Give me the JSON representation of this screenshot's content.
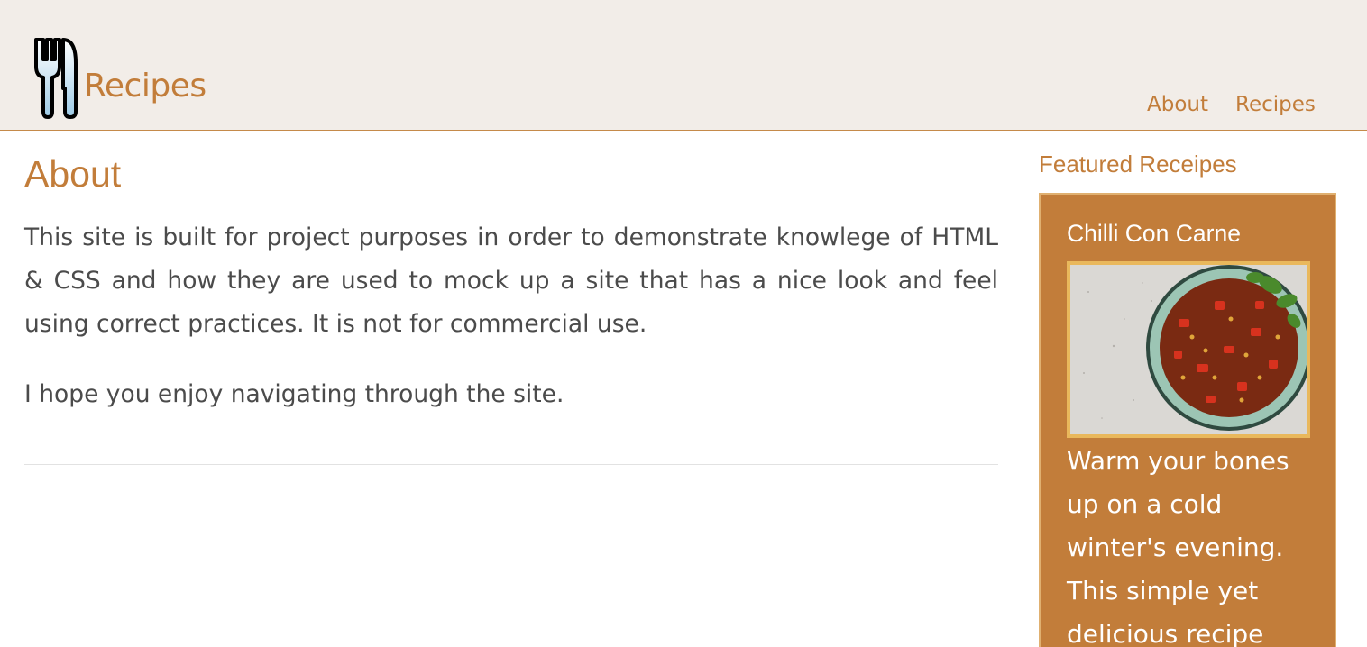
{
  "header": {
    "brand": "Recipes",
    "logo_icon": "cutlery-icon",
    "nav": [
      {
        "label": "About"
      },
      {
        "label": "Recipes"
      }
    ]
  },
  "main": {
    "title": "About",
    "paragraphs": [
      "This site is built for project purposes in order to demonstrate knowlege of HTML & CSS and how they are used to mock up a site that has a nice look and feel using correct practices. It is not for commercial use.",
      "I hope you enjoy navigating through the site."
    ]
  },
  "aside": {
    "title": "Featured Receipes",
    "card": {
      "title": "Chilli Con Carne",
      "image": "chilli-con-carne-photo",
      "text": "Warm your bones up on a cold winter's evening. This simple yet delicious recipe"
    }
  },
  "colors": {
    "accent": "#c27d3a",
    "header_bg": "#f2ede8",
    "card_bg": "#c27d3a",
    "image_border": "#e9b85c"
  }
}
